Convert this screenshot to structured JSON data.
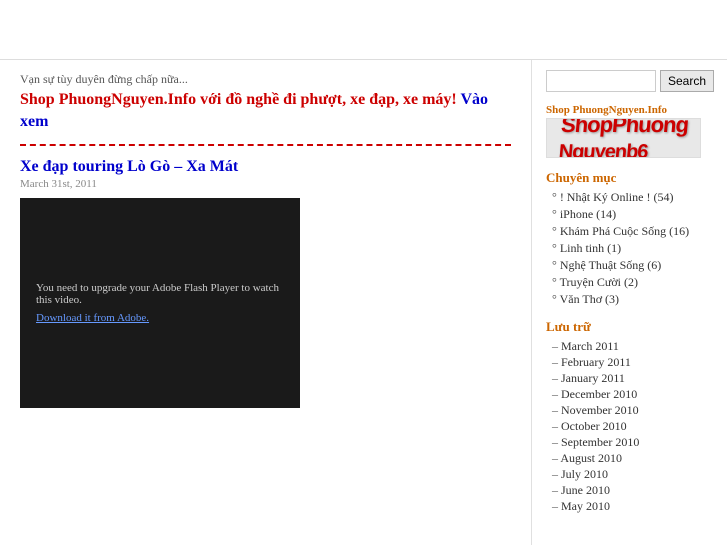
{
  "header": {
    "title": ""
  },
  "main": {
    "promo_small": "Vạn sự tùy duyên đừng chấp nữa...",
    "promo_link_text": "Shop PhuongNguyen.Info với đồ nghề đi phượt, xe đạp, xe máy!",
    "promo_link_cta": " Vào xem",
    "post_title": "Xe đạp touring Lò Gò – Xa Mát",
    "post_date": "March 31st, 2011",
    "video_text": "You need to upgrade your Adobe Flash Player to watch this video.",
    "video_link": "Download it from Adobe."
  },
  "sidebar": {
    "search_placeholder": "",
    "search_button": "Search",
    "shop_label": "Shop PhuongNguyen.Info",
    "shop_logo": "ShopPhuongNguyenInfo",
    "categories_title": "Chuyên mục",
    "categories": [
      {
        "name": "! Nhật Ký Online !",
        "count": "(54)"
      },
      {
        "name": "iPhone",
        "count": "(14)"
      },
      {
        "name": "Khám Phá Cuộc Sống",
        "count": "(16)"
      },
      {
        "name": "Linh tinh",
        "count": "(1)"
      },
      {
        "name": "Nghệ Thuật Sống",
        "count": "(6)"
      },
      {
        "name": "Truyện Cười",
        "count": "(2)"
      },
      {
        "name": "Văn Thơ",
        "count": "(3)"
      }
    ],
    "archive_title": "Lưu trữ",
    "archive": [
      "March 2011",
      "February 2011",
      "January 2011",
      "December 2010",
      "November 2010",
      "October 2010",
      "September 2010",
      "August 2010",
      "July 2010",
      "June 2010",
      "May 2010"
    ]
  }
}
